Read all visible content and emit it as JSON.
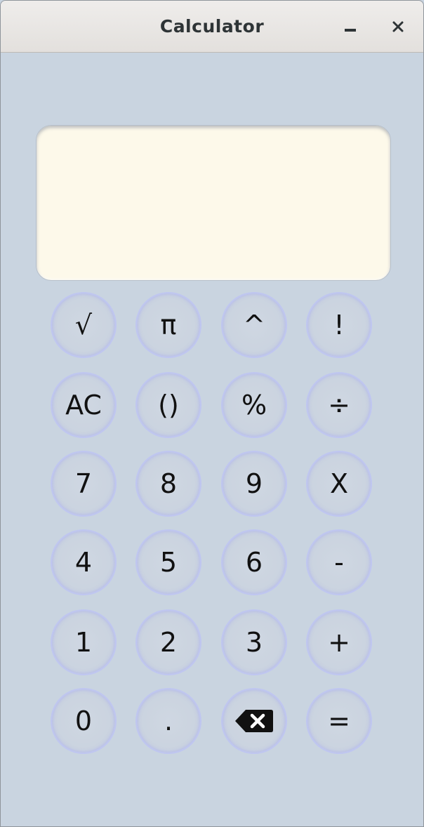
{
  "window": {
    "title": "Calculator",
    "controls": {
      "minimize": "minimize-icon",
      "close": "close-icon"
    }
  },
  "display": {
    "value": ""
  },
  "keys": [
    {
      "label": "√",
      "name": "sqrt-button"
    },
    {
      "label": "π",
      "name": "pi-button"
    },
    {
      "label": "^",
      "name": "power-button"
    },
    {
      "label": "!",
      "name": "factorial-button"
    },
    {
      "label": "AC",
      "name": "clear-button"
    },
    {
      "label": "()",
      "name": "parentheses-button"
    },
    {
      "label": "%",
      "name": "percent-button"
    },
    {
      "label": "÷",
      "name": "divide-button"
    },
    {
      "label": "7",
      "name": "digit-7-button"
    },
    {
      "label": "8",
      "name": "digit-8-button"
    },
    {
      "label": "9",
      "name": "digit-9-button"
    },
    {
      "label": "X",
      "name": "multiply-button"
    },
    {
      "label": "4",
      "name": "digit-4-button"
    },
    {
      "label": "5",
      "name": "digit-5-button"
    },
    {
      "label": "6",
      "name": "digit-6-button"
    },
    {
      "label": "-",
      "name": "subtract-button"
    },
    {
      "label": "1",
      "name": "digit-1-button"
    },
    {
      "label": "2",
      "name": "digit-2-button"
    },
    {
      "label": "3",
      "name": "digit-3-button"
    },
    {
      "label": "+",
      "name": "add-button"
    },
    {
      "label": "0",
      "name": "digit-0-button"
    },
    {
      "label": ".",
      "name": "decimal-button"
    },
    {
      "label": "",
      "name": "backspace-button",
      "icon": "backspace-icon"
    },
    {
      "label": "=",
      "name": "equals-button"
    }
  ],
  "colors": {
    "background": "#c9d4e0",
    "display": "#fdf9ea",
    "key_ring": "#bfc6f0"
  }
}
